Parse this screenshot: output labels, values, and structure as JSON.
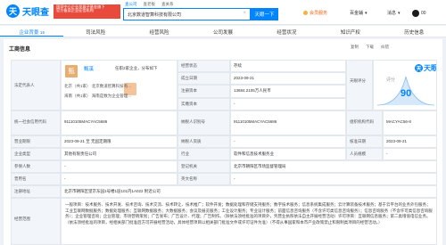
{
  "header": {
    "logo_mark": "天",
    "logo_text": "天眼查",
    "badge_line1": "国家中小企业发展子基金旗下",
    "badge_line2": "官方备案企业征信机构",
    "search_tabs": [
      "查公司",
      "查老板",
      "查关系"
    ],
    "search_value": "北京数道智算科技有限公司",
    "search_button": "天眼一下",
    "nav": {
      "goods": "会员服务",
      "vip": "百金辅",
      "notify": "消息",
      "avatar_count": "00"
    }
  },
  "tabs": [
    {
      "label": "企业背景",
      "count": "15"
    },
    {
      "label": "司法风险",
      "count": ""
    },
    {
      "label": "经营风险",
      "count": ""
    },
    {
      "label": "公司发展",
      "count": ""
    },
    {
      "label": "经营状况",
      "count": ""
    },
    {
      "label": "知识产权",
      "count": ""
    },
    {
      "label": "历史信息",
      "count": ""
    }
  ],
  "section": {
    "title": "工商信息",
    "actions": [
      "复制",
      "下载",
      "纠错"
    ]
  },
  "legal": {
    "label": "法定代表人",
    "avatar": "甄",
    "name": "甄溪",
    "role": "任职2家企业，分布如下",
    "row1": "北京（共1家）  北京数道智算科技有...",
    "row2": "海南（共1家）  海南是数为企业管理..."
  },
  "info": {
    "status_label": "经营状态",
    "status": "存续",
    "founded_label": "成立日期",
    "founded": "2023-09-21",
    "capital_label": "注册资本",
    "capital": "13684.2105万人民币",
    "paid_label": "实缴资本",
    "paid": "-",
    "risk_label": "天眼评分",
    "eval": "评分",
    "score": "90",
    "watermark": "天眼查",
    "credit_label": "统一社会信用代码",
    "credit": "91110105MACYAC5686",
    "tax_label": "纳税人识别号",
    "tax": "91110105MACYAC5686",
    "org_label": "组织机构代码",
    "org": "MACYAC56-8",
    "term_label": "营业期限",
    "term": "2023-09-21 至 无固定期限",
    "taxpayer_label": "纳税人资质",
    "taxpayer": "-",
    "approve_label": "核准日期",
    "approve": "2023-09-21",
    "type_label": "企业类型",
    "type": "其他有限责任公司",
    "industry_label": "行业",
    "industry": "软件和信息技术服务业",
    "staff_label": "人员规模",
    "staff": "-",
    "insured_label": "参保人数",
    "insured": "-",
    "reg_label": "登记机关",
    "reg": "北京市朝阳区市场监督管理局",
    "former_label": "曾用名",
    "former": "-",
    "english_label": "英文名称",
    "english": "-",
    "address_label": "注册地址",
    "address": "北京市朝阳区望京东园1号楼1层101内1A022  附近公司",
    "scope_label": "经营范围",
    "scope": "一般项目：技术服务、技术开发、技术咨询、技术交流、技术转让、技术推广；软件开发；数据处理和存储支持服务；数字技术服务；信息系统集成服务；云计算装备技术服务；基于云平台的业务外包服务；工业互联网数据服务；数据处理服务；互联网数据服务；大数据服务；会议及展览服务；工业设计服务；专业设计服务；前面信息咨询服务（不含许可类信息咨询服务）；信息咨询服务（不含许可类信息咨询服务）；企业管理咨询；企业管理；市场营销策划；广告发布；广告设计、代理；广告制作。（除依法须经批准的项目外，凭营业执照依法自主开展经营活动）许可项目：互联网信息服务；第二类增值电信业务。（依法须经批准的项目，经相关部门批准后方可开展经营活动，具体经营项目以相关部门批准文件或许可证件为准）（不得从事国家和本市产业政策禁止和限制类项目的经营活动。）"
  }
}
